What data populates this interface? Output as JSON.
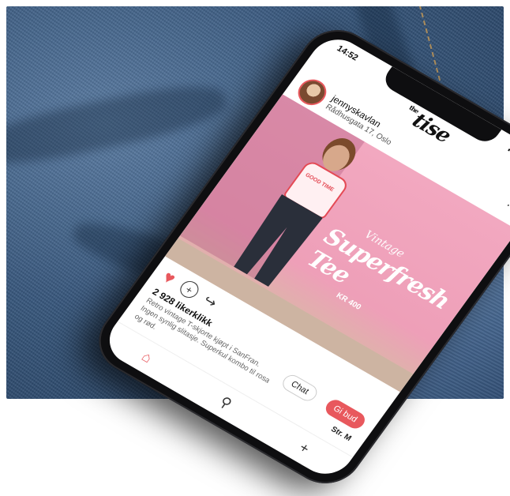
{
  "status": {
    "time": "14:52"
  },
  "app": {
    "logo_prefix": "the",
    "logo": "tise"
  },
  "post": {
    "username": "jennyskavlan",
    "location": "Rådhusgata 17, Oslo",
    "more": "···",
    "hero": {
      "kicker": "Vintage",
      "title": "Superfresh Tee",
      "price": "KR 400",
      "shirt_print": "GOOD TIME"
    },
    "likes": "2 928 likerklikk",
    "caption": "Retro vintage T-skjorte kjøpt i SanFran. Ingen synlig slitasje. Superkul kombo til rosa og rød.",
    "chat_label": "Chat",
    "bid_label": "Gi bud",
    "size_label": "Str. M"
  },
  "icons": [
    "heart-icon",
    "comment-icon",
    "share-icon",
    "home-icon",
    "search-icon",
    "add-icon"
  ],
  "colors": {
    "accent": "#e8585d",
    "hero_bg": "#f2a8c0",
    "denim": "#3a5a80"
  }
}
